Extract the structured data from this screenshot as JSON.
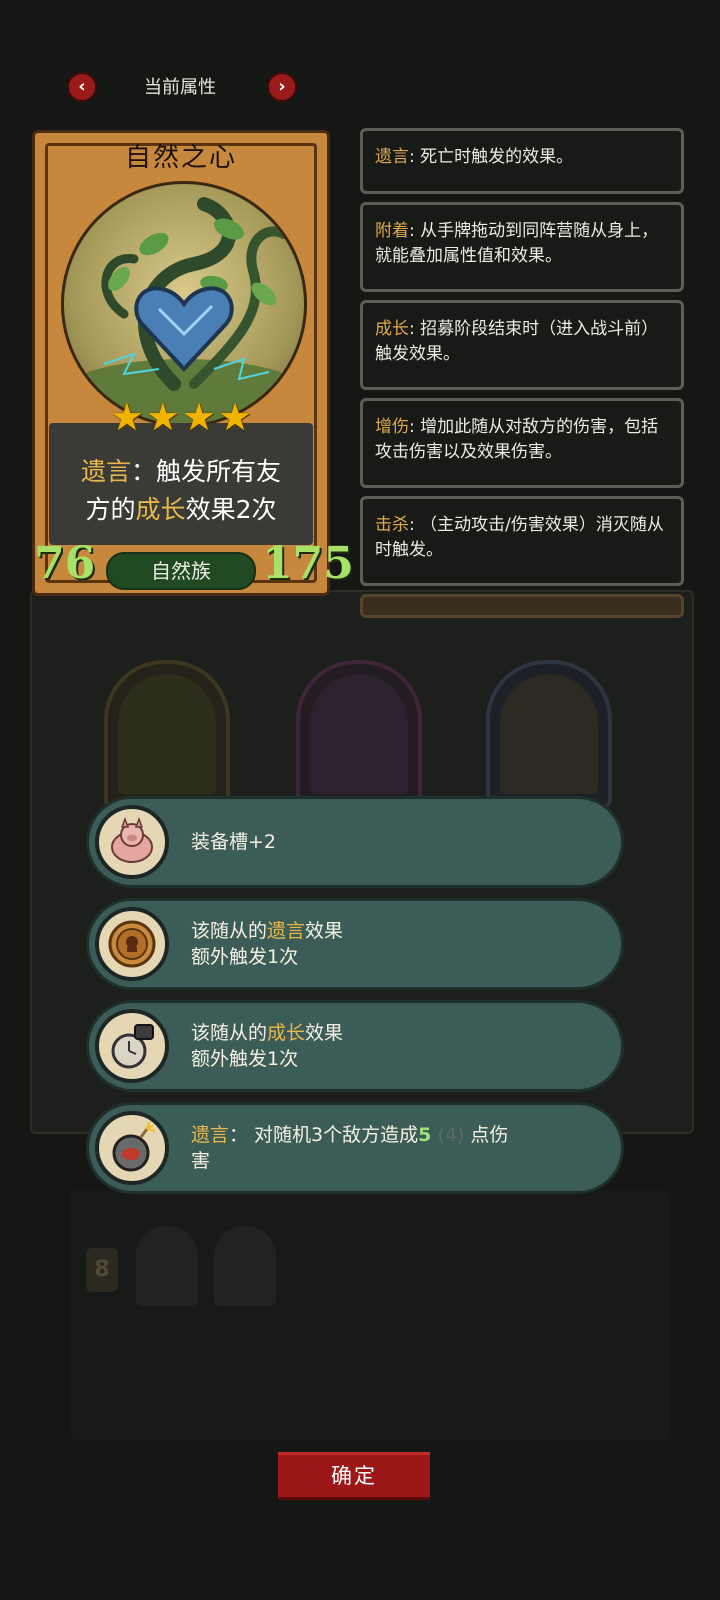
{
  "header": {
    "title": "当前属性",
    "prev_glyph": "‹",
    "next_glyph": "›"
  },
  "card": {
    "name": "自然之心",
    "stars": 4,
    "star_glyph": "★",
    "desc": {
      "kw1": "遗言",
      "sep": "：",
      "part1": "触发所有友",
      "part2": "方的",
      "kw2": "成长",
      "part3": "效果2次"
    },
    "attack": "76",
    "health": "175",
    "tribe": "自然族"
  },
  "keywords": [
    {
      "term": "遗言",
      "text": ": 死亡时触发的效果。"
    },
    {
      "term": "附着",
      "text": ": 从手牌拖动到同阵营随从身上，就能叠加属性值和效果。"
    },
    {
      "term": "成长",
      "text": ": 招募阶段结束时（进入战斗前）触发效果。"
    },
    {
      "term": "增伤",
      "text": ": 增加此随从对敌方的伤害，包括攻击伤害以及效果伤害。"
    },
    {
      "term": "击杀",
      "text": ": （主动攻击/伤害效果）消灭随从时触发。"
    }
  ],
  "effects": [
    {
      "icon": "pig-icon",
      "text": "装备槽+2"
    },
    {
      "icon": "coin-icon",
      "pre": "该随从的",
      "kw": "遗言",
      "post": "效果",
      "line2": "额外触发1次"
    },
    {
      "icon": "stopwatch-icon",
      "pre": "该随从的",
      "kw": "成长",
      "post": "效果",
      "line2": "额外触发1次"
    },
    {
      "icon": "bomb-icon",
      "kw": "遗言",
      "pre": "：  对随机3个敌方造成",
      "num": "5",
      "dim": "(4)",
      "post": "点伤",
      "line2": "害"
    }
  ],
  "confirm_label": "确定",
  "colors": {
    "keyword": "#e6b84c",
    "stat": "#a9e067",
    "effect_bg": "#3c5d57",
    "confirm_bg": "#9c1717"
  }
}
